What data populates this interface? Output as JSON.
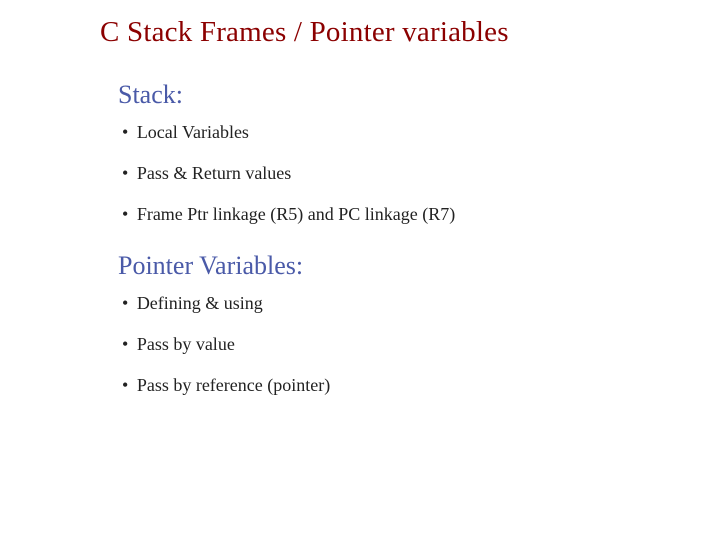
{
  "title": "C Stack Frames  / Pointer variables",
  "section1": {
    "heading": "Stack:",
    "items": [
      "Local Variables",
      "Pass & Return values",
      "Frame Ptr linkage (R5) and PC linkage (R7)"
    ]
  },
  "section2": {
    "heading": "Pointer Variables:",
    "items": [
      "Defining & using",
      "Pass by value",
      "Pass by reference (pointer)"
    ]
  }
}
